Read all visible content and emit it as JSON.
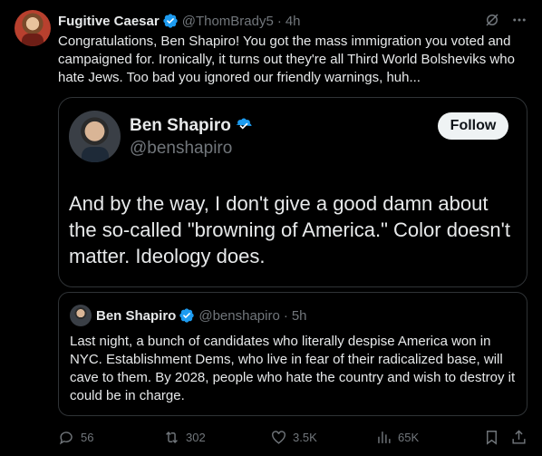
{
  "tweet": {
    "author_name": "Fugitive Caesar",
    "author_handle": "@ThomBrady5",
    "separator": "·",
    "time": "4h",
    "text": "Congratulations, Ben Shapiro! You got the mass immigration you voted and campaigned for. Ironically, it turns out they're all Third World Bolsheviks who hate Jews. Too bad you ignored our friendly warnings, huh..."
  },
  "card": {
    "name": "Ben Shapiro",
    "handle": "@benshapiro",
    "follow_label": "Follow",
    "text": "And by the way, I don't give a good damn about the so-called \"browning of America.\" Color doesn't matter. Ideology does."
  },
  "quote": {
    "name": "Ben Shapiro",
    "handle": "@benshapiro",
    "separator": "·",
    "time": "5h",
    "text": "Last night, a bunch of candidates who literally despise America won in NYC. Establishment Dems, who live in fear of their radicalized base, will cave to them. By 2028, people who hate the country and wish to destroy it could be in charge."
  },
  "actions": {
    "replies": "56",
    "reposts": "302",
    "likes": "3.5K",
    "views": "65K"
  },
  "colors": {
    "background": "#000000",
    "text": "#e7e9ea",
    "muted": "#71767b",
    "verified": "#1d9bf0",
    "border": "#2f3336"
  },
  "icons": [
    "verified-badge-icon",
    "grok-icon",
    "more-icon",
    "reply-icon",
    "repost-icon",
    "like-icon",
    "views-icon",
    "bookmark-icon",
    "share-icon"
  ]
}
